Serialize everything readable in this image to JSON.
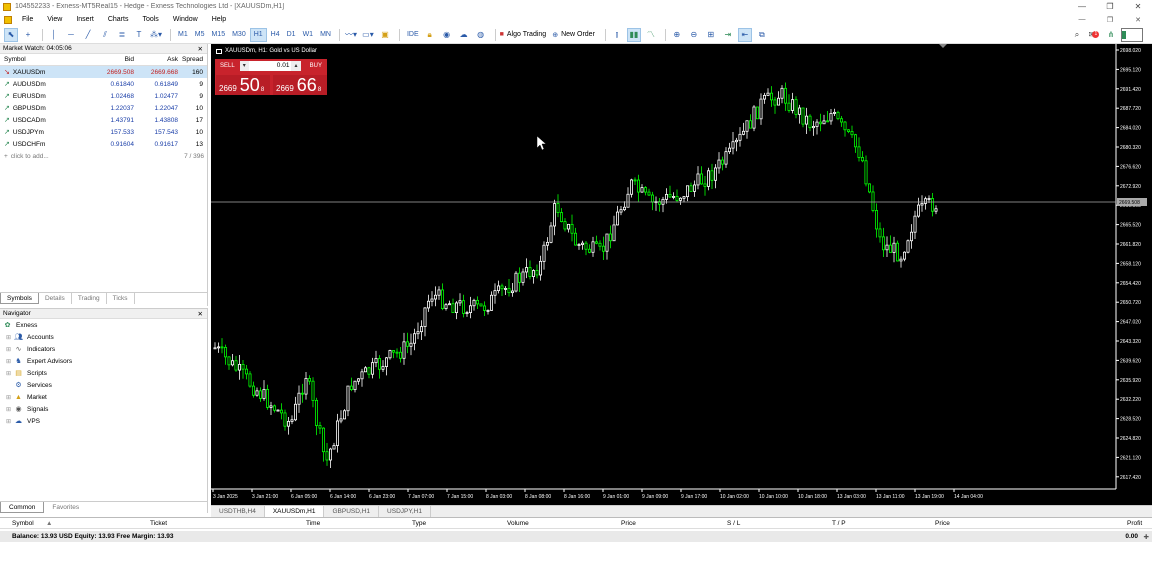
{
  "window": {
    "title": "104552233 - Exness-MT5Real15 - Hedge - Exness Technologies Ltd - [XAUUSDm,H1]"
  },
  "menu": [
    "File",
    "View",
    "Insert",
    "Charts",
    "Tools",
    "Window",
    "Help"
  ],
  "toolbar": {
    "timeframes": [
      "M1",
      "M5",
      "M15",
      "M30",
      "H1",
      "H4",
      "D1",
      "W1",
      "MN"
    ],
    "selected_timeframe": "H1",
    "ide_label": "IDE",
    "algo_label": "Algo Trading",
    "neworder_label": "New Order"
  },
  "market_watch": {
    "title": "Market Watch: 04:05:06",
    "columns": [
      "Symbol",
      "Bid",
      "Ask",
      "Spread"
    ],
    "rows": [
      {
        "symbol": "XAUUSDm",
        "bid": "2669.508",
        "ask": "2669.668",
        "spread": "160"
      },
      {
        "symbol": "AUDUSDm",
        "bid": "0.61840",
        "ask": "0.61849",
        "spread": "9"
      },
      {
        "symbol": "EURUSDm",
        "bid": "1.02468",
        "ask": "1.02477",
        "spread": "9"
      },
      {
        "symbol": "GBPUSDm",
        "bid": "1.22037",
        "ask": "1.22047",
        "spread": "10"
      },
      {
        "symbol": "USDCADm",
        "bid": "1.43791",
        "ask": "1.43808",
        "spread": "17"
      },
      {
        "symbol": "USDJPYm",
        "bid": "157.533",
        "ask": "157.543",
        "spread": "10"
      },
      {
        "symbol": "USDCHFm",
        "bid": "0.91604",
        "ask": "0.91617",
        "spread": "13"
      }
    ],
    "add_label": "click to add...",
    "count": "7 / 396",
    "tabs": [
      "Symbols",
      "Details",
      "Trading",
      "Ticks"
    ]
  },
  "navigator": {
    "title": "Navigator",
    "root": "Exness",
    "items": [
      "Accounts",
      "Indicators",
      "Expert Advisors",
      "Scripts",
      "Services",
      "Market",
      "Signals",
      "VPS"
    ],
    "tabs": [
      "Common",
      "Favorites"
    ]
  },
  "chart": {
    "title": "XAUUSDm, H1:  Gold vs US Dollar",
    "sell_label": "SELL",
    "buy_label": "BUY",
    "volume": "0.01",
    "sell_price_small": "2669",
    "sell_price_big": "50",
    "sell_price_sup": "8",
    "buy_price_small": "2669",
    "buy_price_big": "66",
    "buy_price_sup": "8",
    "current_price": "2669.508",
    "price_labels": [
      "2698.020",
      "2695.120",
      "2691.420",
      "2687.720",
      "2684.020",
      "2680.320",
      "2676.620",
      "2672.920",
      "2669.508",
      "2665.520",
      "2661.820",
      "2658.120",
      "2654.420",
      "2650.720",
      "2647.020",
      "2643.320",
      "2639.620",
      "2635.920",
      "2632.220",
      "2628.520",
      "2624.820",
      "2621.120",
      "2617.420"
    ],
    "time_labels": [
      "3 Jan 2025",
      "3 Jan 21:00",
      "6 Jan 05:00",
      "6 Jan 14:00",
      "6 Jan 23:00",
      "7 Jan 07:00",
      "7 Jan 15:00",
      "8 Jan 03:00",
      "8 Jan 08:00",
      "8 Jan 16:00",
      "9 Jan 01:00",
      "9 Jan 09:00",
      "9 Jan 17:00",
      "10 Jan 02:00",
      "10 Jan 10:00",
      "10 Jan 18:00",
      "13 Jan 03:00",
      "13 Jan 11:00",
      "13 Jan 19:00",
      "14 Jan 04:00"
    ],
    "tabs": [
      "USDTHB,H4",
      "XAUUSDm,H1",
      "GBPUSD,H1",
      "USDJPY,H1"
    ],
    "active_tab": "XAUUSDm,H1"
  },
  "terminal": {
    "columns": [
      "Symbol",
      "Ticket",
      "Time",
      "Type",
      "Volume",
      "Price",
      "S / L",
      "T / P",
      "Price",
      "Profit"
    ],
    "balance_line": "Balance: 13.93 USD  Equity: 13.93  Free Margin: 13.93",
    "profit": "0.00"
  },
  "colors": {
    "bull": "#ffffff",
    "bear": "#00ff00",
    "bg": "#000000",
    "accent": "#c8232c"
  }
}
